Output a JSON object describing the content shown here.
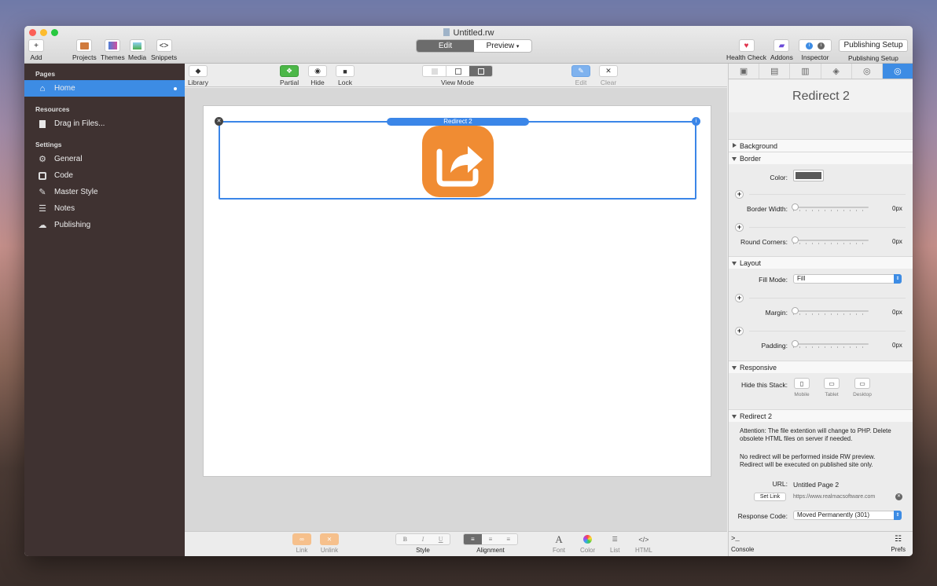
{
  "window": {
    "title": "Untitled.rw"
  },
  "toolbar": {
    "left": [
      {
        "label": "Add",
        "icon": "plus-icon"
      },
      {
        "label": "Projects",
        "icon": "projects-icon"
      },
      {
        "label": "Themes",
        "icon": "themes-icon"
      },
      {
        "label": "Media",
        "icon": "media-icon"
      },
      {
        "label": "Snippets",
        "icon": "snippets-icon"
      }
    ],
    "mode_edit": "Edit",
    "mode_preview": "Preview",
    "right": [
      {
        "label": "Health Check",
        "icon": "heart-icon"
      },
      {
        "label": "Addons",
        "icon": "addons-icon"
      },
      {
        "label": "Inspector",
        "icon": "info-icon"
      }
    ],
    "publishing_button": "Publishing Setup",
    "publishing_label": "Publishing Setup"
  },
  "sidebar": {
    "pages_header": "Pages",
    "home": "Home",
    "resources_header": "Resources",
    "drag_files": "Drag in Files...",
    "settings_header": "Settings",
    "settings_items": [
      "General",
      "Code",
      "Master Style",
      "Notes",
      "Publishing"
    ]
  },
  "editbar": {
    "library": "Library",
    "partial": "Partial",
    "hide": "Hide",
    "lock": "Lock",
    "view_mode": "View Mode",
    "edit": "Edit",
    "clear": "Clear"
  },
  "canvas": {
    "stack_label": "Redirect 2"
  },
  "bottombar": {
    "link": "Link",
    "unlink": "Unlink",
    "style": "Style",
    "style_buttons": [
      "B",
      "I",
      "U"
    ],
    "alignment": "Alignment",
    "font": "Font",
    "color": "Color",
    "list": "List",
    "html": "HTML",
    "font_glyph": "A",
    "html_glyph": "</>"
  },
  "inspector": {
    "title": "Redirect 2",
    "background": "Background",
    "border": "Border",
    "color_label": "Color:",
    "border_color": "#5a5a5a",
    "border_width_label": "Border Width:",
    "border_width": "0px",
    "round_corners_label": "Round Corners:",
    "round_corners": "0px",
    "layout": "Layout",
    "fill_mode_label": "Fill Mode:",
    "fill_mode": "Fill",
    "margin_label": "Margin:",
    "margin": "0px",
    "padding_label": "Padding:",
    "padding": "0px",
    "responsive": "Responsive",
    "hide_stack_label": "Hide this Stack:",
    "devices": [
      "Mobile",
      "Tablet",
      "Desktop"
    ],
    "redirect_section": "Redirect 2",
    "attention": "Attention: The file extention will change to PHP. Delete obsolete HTML files on server if needed.",
    "no_redirect": "No redirect will be performed inside RW preview.",
    "redirect_exec": "Redirect will be executed on published site only.",
    "url_label": "URL:",
    "url_value": "Untitled Page 2",
    "set_link": "Set Link",
    "link_url": "https://www.realmacsoftware.com",
    "response_label": "Response Code:",
    "response_code": "Moved Permanently (301)",
    "console": "Console",
    "prefs": "Prefs",
    "console_glyph": ">_"
  },
  "colors": {
    "accent": "#3d8ce4",
    "stack_icon": "#f08c33",
    "sidebar": "#3f3231"
  }
}
